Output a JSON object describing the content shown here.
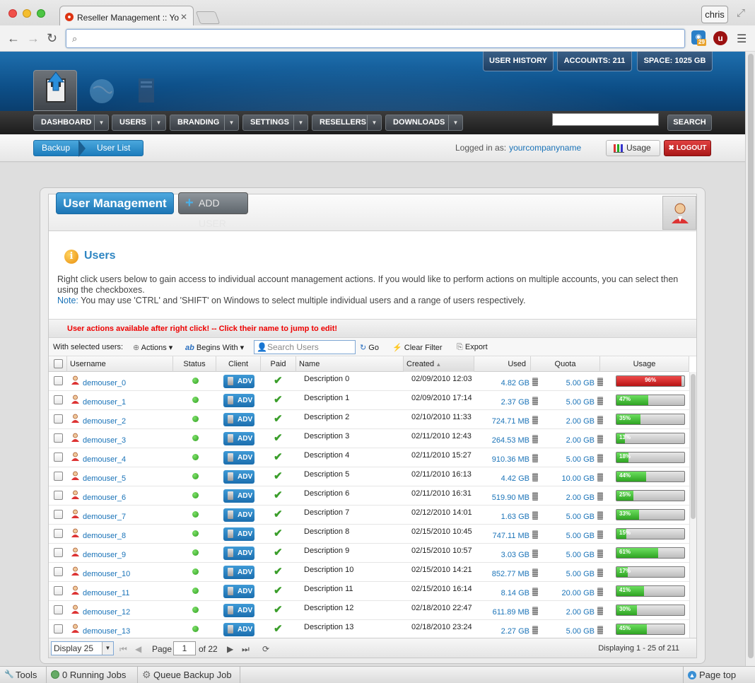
{
  "browser": {
    "tab_title": "Reseller Management :: Yo",
    "profile_name": "chris",
    "extension_badge": "29",
    "address": ""
  },
  "header_stats": [
    {
      "label": "USER HISTORY"
    },
    {
      "label": "ACCOUNTS: 211"
    },
    {
      "label": "SPACE: 1025 GB"
    }
  ],
  "nav": {
    "items": [
      {
        "label": "DASHBOARD"
      },
      {
        "label": "USERS"
      },
      {
        "label": "BRANDING"
      },
      {
        "label": "SETTINGS"
      },
      {
        "label": "RESELLERS"
      },
      {
        "label": "DOWNLOADS"
      }
    ],
    "search_button": "SEARCH"
  },
  "breadcrumb": {
    "first": "Backup",
    "second": "User List"
  },
  "session": {
    "logged_in_label": "Logged in as:",
    "username": "yourcompanyname",
    "usage_label": "Usage",
    "logout_label": "LOGOUT"
  },
  "panel": {
    "title": "User Management",
    "add_user_label": "ADD USER",
    "section_title": "Users",
    "description": "Right click users below to gain access to individual account management actions. If you would like to perform actions on multiple accounts, you can select then using the checkboxes.",
    "note_label": "Note:",
    "note_text": " You may use 'CTRL' and 'SHIFT' on Windows to select multiple individual users and a range of users respectively.",
    "warning": "User actions available after right click! -- Click their name to jump to edit!"
  },
  "toolbar": {
    "with_selected": "With selected users:",
    "actions": "Actions",
    "begins_with": "Begins With",
    "search_placeholder": "Search Users",
    "go": "Go",
    "clear_filter": "Clear Filter",
    "export": "Export"
  },
  "grid": {
    "columns": [
      "Username",
      "Status",
      "Client",
      "Paid",
      "Name",
      "Created",
      "Used",
      "Quota",
      "Usage"
    ],
    "client_label": "ADV",
    "rows": [
      {
        "username": "demouser_0",
        "name": "Description 0",
        "created": "02/09/2010 12:03",
        "used": "4.82 GB",
        "quota": "5.00 GB",
        "usage": 96
      },
      {
        "username": "demouser_1",
        "name": "Description 1",
        "created": "02/09/2010 17:14",
        "used": "2.37 GB",
        "quota": "5.00 GB",
        "usage": 47
      },
      {
        "username": "demouser_2",
        "name": "Description 2",
        "created": "02/10/2010 11:33",
        "used": "724.71 MB",
        "quota": "2.00 GB",
        "usage": 35
      },
      {
        "username": "demouser_3",
        "name": "Description 3",
        "created": "02/11/2010 12:43",
        "used": "264.53 MB",
        "quota": "2.00 GB",
        "usage": 13
      },
      {
        "username": "demouser_4",
        "name": "Description 4",
        "created": "02/11/2010 15:27",
        "used": "910.36 MB",
        "quota": "5.00 GB",
        "usage": 18
      },
      {
        "username": "demouser_5",
        "name": "Description 5",
        "created": "02/11/2010 16:13",
        "used": "4.42 GB",
        "quota": "10.00 GB",
        "usage": 44
      },
      {
        "username": "demouser_6",
        "name": "Description 6",
        "created": "02/11/2010 16:31",
        "used": "519.90 MB",
        "quota": "2.00 GB",
        "usage": 25
      },
      {
        "username": "demouser_7",
        "name": "Description 7",
        "created": "02/12/2010 14:01",
        "used": "1.63 GB",
        "quota": "5.00 GB",
        "usage": 33
      },
      {
        "username": "demouser_8",
        "name": "Description 8",
        "created": "02/15/2010 10:45",
        "used": "747.11 MB",
        "quota": "5.00 GB",
        "usage": 15
      },
      {
        "username": "demouser_9",
        "name": "Description 9",
        "created": "02/15/2010 10:57",
        "used": "3.03 GB",
        "quota": "5.00 GB",
        "usage": 61
      },
      {
        "username": "demouser_10",
        "name": "Description 10",
        "created": "02/15/2010 14:21",
        "used": "852.77 MB",
        "quota": "5.00 GB",
        "usage": 17
      },
      {
        "username": "demouser_11",
        "name": "Description 11",
        "created": "02/15/2010 16:14",
        "used": "8.14 GB",
        "quota": "20.00 GB",
        "usage": 41
      },
      {
        "username": "demouser_12",
        "name": "Description 12",
        "created": "02/18/2010 22:47",
        "used": "611.89 MB",
        "quota": "2.00 GB",
        "usage": 30
      },
      {
        "username": "demouser_13",
        "name": "Description 13",
        "created": "02/18/2010 23:24",
        "used": "2.27 GB",
        "quota": "5.00 GB",
        "usage": 45
      }
    ]
  },
  "pager": {
    "display": "Display 25",
    "page_label": "Page",
    "page": "1",
    "of_pages": "of 22",
    "summary": "Displaying 1 - 25 of 211"
  },
  "status_bar": {
    "tools": "Tools",
    "running_jobs": "0 Running Jobs",
    "queue_backup": "Queue Backup Job",
    "page_top": "Page top"
  },
  "colors": {
    "accent": "#1c7cbc",
    "danger": "#b81515",
    "success": "#2ea322"
  }
}
